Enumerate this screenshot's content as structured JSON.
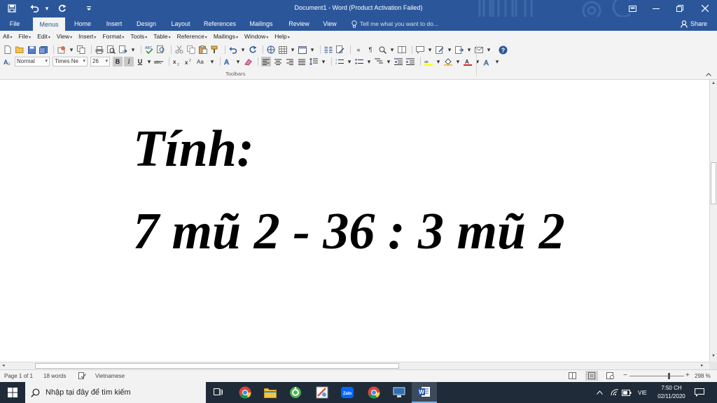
{
  "window": {
    "title": "Document1 - Word (Product Activation Failed)"
  },
  "tabs": [
    {
      "label": "File"
    },
    {
      "label": "Menus"
    },
    {
      "label": "Home"
    },
    {
      "label": "Insert"
    },
    {
      "label": "Design"
    },
    {
      "label": "Layout"
    },
    {
      "label": "References"
    },
    {
      "label": "Mailings"
    },
    {
      "label": "Review"
    },
    {
      "label": "View"
    }
  ],
  "tell_me": {
    "placeholder": "Tell me what you want to do..."
  },
  "share_label": "Share",
  "menus": [
    "All",
    "File",
    "Edit",
    "View",
    "Insert",
    "Format",
    "Tools",
    "Table",
    "Reference",
    "Mailings",
    "Window",
    "Help"
  ],
  "formatting": {
    "style": "Normal",
    "font": "Times Ne",
    "size": "26",
    "bold": "B",
    "italic": "I",
    "underline": "U"
  },
  "toolbars_label": "Toolbars",
  "document": {
    "line1": "Tính:",
    "line2": "7 mũ 2 - 36 : 3 mũ 2"
  },
  "status": {
    "page": "Page 1 of 1",
    "words": "18 words",
    "language": "Vietnamese",
    "zoom": "298 %"
  },
  "taskbar": {
    "search_placeholder": "Nhập tại đây để tìm kiếm",
    "language": "VIE",
    "time": "7:50 CH",
    "date": "02/11/2020"
  },
  "colors": {
    "word_blue": "#2b579a",
    "taskbar": "#1f2b38"
  }
}
